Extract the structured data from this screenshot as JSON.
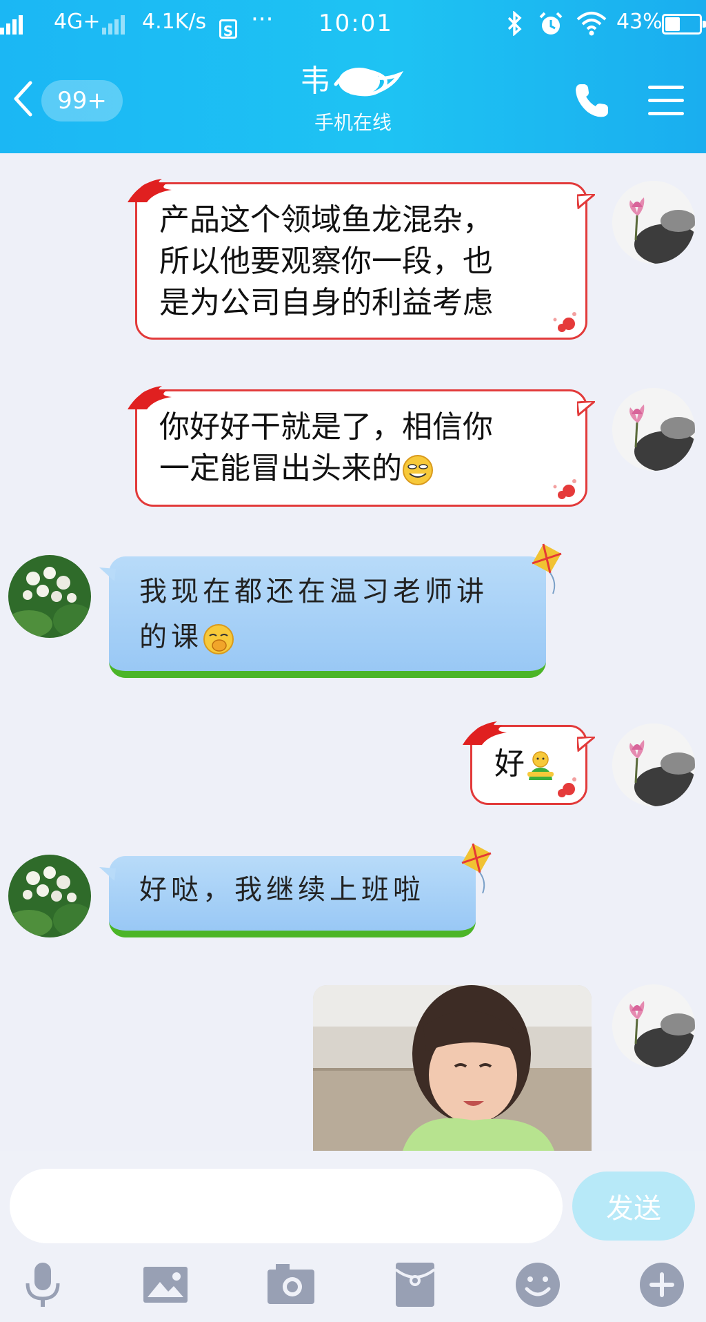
{
  "status_bar": {
    "network": "4G+",
    "speed": "4.1K/s",
    "app_badge": "S",
    "more": "···",
    "time": "10:01",
    "battery": "43%"
  },
  "header": {
    "unread_count": "99+",
    "contact_name": "韦",
    "contact_status": "手机在线"
  },
  "messages": [
    {
      "side": "right",
      "type": "text",
      "lines": [
        "产品这个领域鱼龙混杂，",
        "所以他要观察你一段，也",
        "是为公司自身的利益考虑"
      ]
    },
    {
      "side": "right",
      "type": "text",
      "lines": [
        "你好好干就是了，相信你",
        "一定能冒出头来的"
      ],
      "emoji": "grin-emoji"
    },
    {
      "side": "left",
      "type": "text",
      "lines": [
        "我现在都还在温习老师讲",
        "的课"
      ],
      "emoji": "shy-emoji"
    },
    {
      "side": "right",
      "type": "text",
      "lines": [
        "好"
      ],
      "emoji": "green-figure-emoji"
    },
    {
      "side": "left",
      "type": "text",
      "lines": [
        "好哒，我继续上班啦"
      ]
    },
    {
      "side": "right",
      "type": "image",
      "description_icon": "photo-child"
    }
  ],
  "input": {
    "value": "",
    "send_label": "发送"
  },
  "toolbar": [
    "microphone-icon",
    "picture-icon",
    "camera-icon",
    "red-packet-icon",
    "smiley-icon",
    "plus-icon"
  ],
  "colors": {
    "header": "#1cbaf3",
    "background": "#eef0f8",
    "red_bubble_border": "#e23a3a",
    "blue_bubble": "#a8d2f7",
    "grass": "#4bb527",
    "send_button": "#b7e9f8",
    "toolbar_icon": "#98a0b4"
  }
}
